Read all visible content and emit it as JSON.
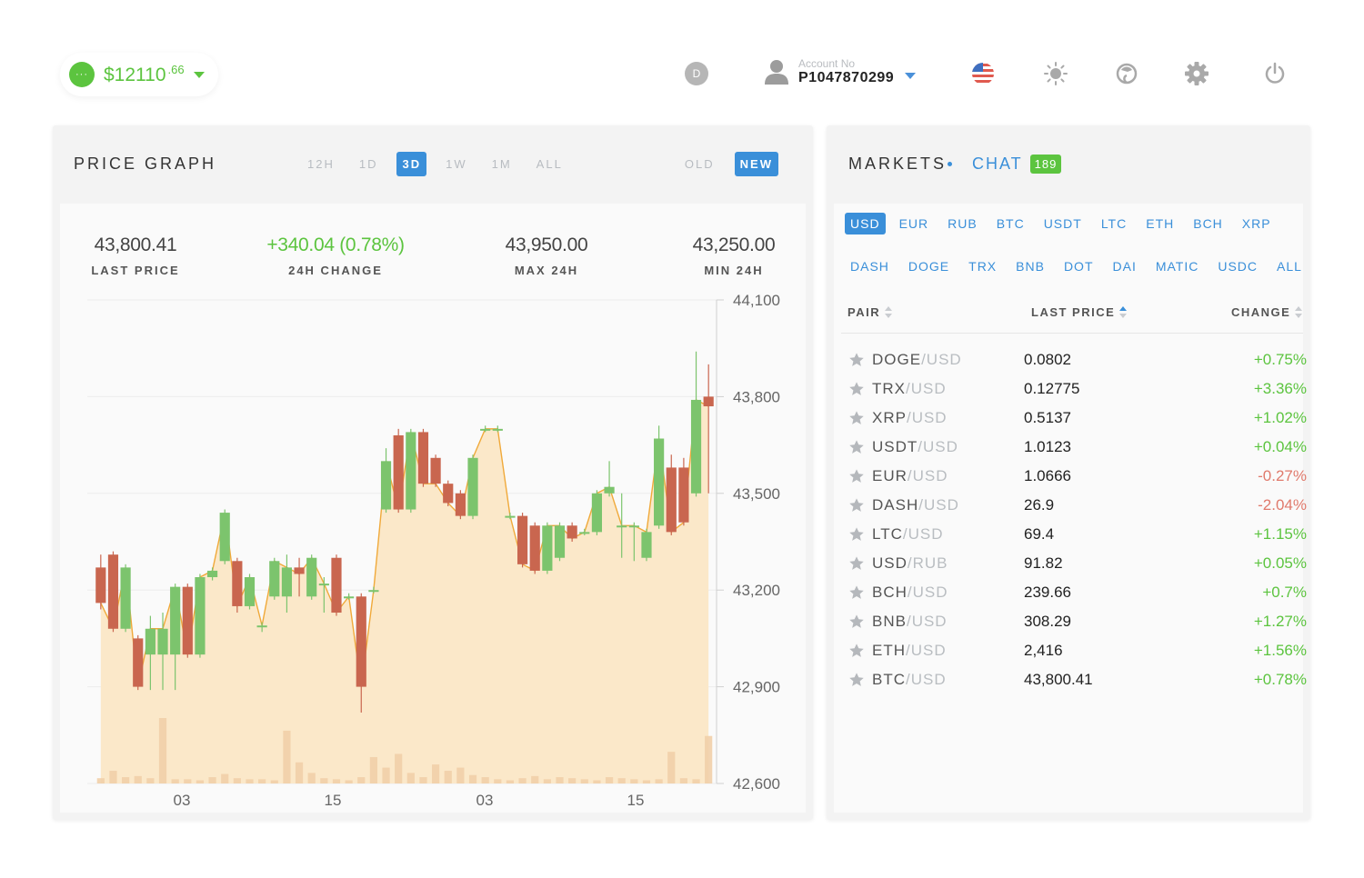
{
  "header": {
    "balance_main": "$12110",
    "balance_cents": ".66",
    "balance_dot": "···",
    "user_initial": "D",
    "account_label": "Account No",
    "account_number": "P1047870299"
  },
  "price_graph": {
    "title": "PRICE GRAPH",
    "range_tabs": [
      "12H",
      "1D",
      "3D",
      "1W",
      "1M",
      "ALL"
    ],
    "active_range": "3D",
    "version_tabs": [
      "OLD",
      "NEW"
    ],
    "active_version": "NEW",
    "stats": {
      "last_price": {
        "value": "43,800.41",
        "label": "LAST PRICE"
      },
      "change_24h": {
        "value": "+340.04 (0.78%)",
        "label": "24H CHANGE"
      },
      "max_24h": {
        "value": "43,950.00",
        "label": "MAX 24H"
      },
      "min_24h": {
        "value": "43,250.00",
        "label": "MIN 24H"
      }
    }
  },
  "colors": {
    "accent": "#3a8fd9",
    "positive": "#5cc43f",
    "negative": "#e07a6c",
    "candle_up": "#7cc46d",
    "candle_down": "#c9664f",
    "area_fill": "#fbe8c9",
    "line": "#f0a93a"
  },
  "chart_data": {
    "type": "candlestick",
    "y_ticks": [
      "44,100",
      "43,800",
      "43,500",
      "43,200",
      "42,900",
      "42,600"
    ],
    "x_ticks": [
      "03",
      "15",
      "03",
      "15"
    ],
    "ylim": [
      42600,
      44100
    ],
    "candles": [
      {
        "o": 43270,
        "c": 43160,
        "h": 43310,
        "l": 43140
      },
      {
        "o": 43310,
        "c": 43080,
        "h": 43320,
        "l": 43070
      },
      {
        "o": 43080,
        "c": 43270,
        "h": 43280,
        "l": 43070
      },
      {
        "o": 43050,
        "c": 42900,
        "h": 43060,
        "l": 42890
      },
      {
        "o": 43000,
        "c": 43080,
        "h": 43120,
        "l": 42890
      },
      {
        "o": 43000,
        "c": 43080,
        "h": 43130,
        "l": 42890
      },
      {
        "o": 43000,
        "c": 43210,
        "h": 43220,
        "l": 42890
      },
      {
        "o": 43210,
        "c": 43000,
        "h": 43220,
        "l": 42990
      },
      {
        "o": 43000,
        "c": 43240,
        "h": 43250,
        "l": 42990
      },
      {
        "o": 43240,
        "c": 43260,
        "h": 43270,
        "l": 43230
      },
      {
        "o": 43290,
        "c": 43440,
        "h": 43450,
        "l": 43280
      },
      {
        "o": 43290,
        "c": 43150,
        "h": 43300,
        "l": 43130
      },
      {
        "o": 43150,
        "c": 43240,
        "h": 43250,
        "l": 43140
      },
      {
        "o": 43090,
        "c": 43090,
        "h": 43100,
        "l": 43070
      },
      {
        "o": 43180,
        "c": 43290,
        "h": 43300,
        "l": 43170
      },
      {
        "o": 43180,
        "c": 43270,
        "h": 43310,
        "l": 43130
      },
      {
        "o": 43270,
        "c": 43250,
        "h": 43300,
        "l": 43180
      },
      {
        "o": 43180,
        "c": 43300,
        "h": 43310,
        "l": 43170
      },
      {
        "o": 43220,
        "c": 43220,
        "h": 43240,
        "l": 43130
      },
      {
        "o": 43300,
        "c": 43130,
        "h": 43310,
        "l": 43120
      },
      {
        "o": 43180,
        "c": 43180,
        "h": 43190,
        "l": 43170
      },
      {
        "o": 43180,
        "c": 42900,
        "h": 43190,
        "l": 42820
      },
      {
        "o": 43200,
        "c": 43200,
        "h": 43210,
        "l": 43190
      },
      {
        "o": 43450,
        "c": 43600,
        "h": 43640,
        "l": 43440
      },
      {
        "o": 43680,
        "c": 43450,
        "h": 43700,
        "l": 43440
      },
      {
        "o": 43450,
        "c": 43690,
        "h": 43700,
        "l": 43440
      },
      {
        "o": 43690,
        "c": 43530,
        "h": 43700,
        "l": 43520
      },
      {
        "o": 43610,
        "c": 43530,
        "h": 43620,
        "l": 43520
      },
      {
        "o": 43530,
        "c": 43470,
        "h": 43540,
        "l": 43460
      },
      {
        "o": 43500,
        "c": 43430,
        "h": 43510,
        "l": 43420
      },
      {
        "o": 43430,
        "c": 43610,
        "h": 43620,
        "l": 43420
      },
      {
        "o": 43700,
        "c": 43700,
        "h": 43710,
        "l": 43690
      },
      {
        "o": 43700,
        "c": 43700,
        "h": 43710,
        "l": 43690
      },
      {
        "o": 43430,
        "c": 43430,
        "h": 43440,
        "l": 43420
      },
      {
        "o": 43430,
        "c": 43280,
        "h": 43440,
        "l": 43270
      },
      {
        "o": 43400,
        "c": 43260,
        "h": 43410,
        "l": 43250
      },
      {
        "o": 43260,
        "c": 43400,
        "h": 43410,
        "l": 43250
      },
      {
        "o": 43300,
        "c": 43400,
        "h": 43410,
        "l": 43290
      },
      {
        "o": 43400,
        "c": 43360,
        "h": 43410,
        "l": 43350
      },
      {
        "o": 43380,
        "c": 43380,
        "h": 43390,
        "l": 43370
      },
      {
        "o": 43380,
        "c": 43500,
        "h": 43510,
        "l": 43370
      },
      {
        "o": 43500,
        "c": 43520,
        "h": 43600,
        "l": 43490
      },
      {
        "o": 43400,
        "c": 43400,
        "h": 43500,
        "l": 43300
      },
      {
        "o": 43400,
        "c": 43400,
        "h": 43410,
        "l": 43290
      },
      {
        "o": 43300,
        "c": 43380,
        "h": 43390,
        "l": 43290
      },
      {
        "o": 43400,
        "c": 43670,
        "h": 43710,
        "l": 43390
      },
      {
        "o": 43580,
        "c": 43380,
        "h": 43620,
        "l": 43370
      },
      {
        "o": 43580,
        "c": 43410,
        "h": 43610,
        "l": 43400
      },
      {
        "o": 43500,
        "c": 43790,
        "h": 43940,
        "l": 43490
      },
      {
        "o": 43800,
        "c": 43770,
        "h": 43900,
        "l": 43500
      }
    ],
    "volumes": [
      5,
      12,
      6,
      7,
      5,
      62,
      4,
      4,
      3,
      6,
      9,
      5,
      4,
      4,
      3,
      50,
      20,
      10,
      5,
      4,
      3,
      6,
      25,
      15,
      28,
      10,
      6,
      18,
      12,
      15,
      8,
      6,
      4,
      3,
      5,
      7,
      4,
      6,
      5,
      4,
      3,
      6,
      5,
      4,
      3,
      4,
      30,
      5,
      4,
      45
    ]
  },
  "markets": {
    "title": "MARKETS",
    "chat_label": "CHAT",
    "chat_count": "189",
    "currency_row1": [
      "USD",
      "EUR",
      "RUB",
      "BTC",
      "USDT",
      "LTC",
      "ETH",
      "BCH",
      "XRP"
    ],
    "currency_row2": [
      "DASH",
      "DOGE",
      "TRX",
      "BNB",
      "DOT",
      "DAI",
      "MATIC",
      "USDC",
      "ALL"
    ],
    "active_currency": "USD",
    "columns": {
      "pair": "PAIR",
      "last_price": "LAST PRICE",
      "change": "CHANGE"
    },
    "rows": [
      {
        "base": "DOGE",
        "quote": "/USD",
        "price": "0.0802",
        "change": "+0.75%",
        "positive": true
      },
      {
        "base": "TRX",
        "quote": "/USD",
        "price": "0.12775",
        "change": "+3.36%",
        "positive": true
      },
      {
        "base": "XRP",
        "quote": "/USD",
        "price": "0.5137",
        "change": "+1.02%",
        "positive": true
      },
      {
        "base": "USDT",
        "quote": "/USD",
        "price": "1.0123",
        "change": "+0.04%",
        "positive": true
      },
      {
        "base": "EUR",
        "quote": "/USD",
        "price": "1.0666",
        "change": "-0.27%",
        "positive": false
      },
      {
        "base": "DASH",
        "quote": "/USD",
        "price": "26.9",
        "change": "-2.04%",
        "positive": false
      },
      {
        "base": "LTC",
        "quote": "/USD",
        "price": "69.4",
        "change": "+1.15%",
        "positive": true
      },
      {
        "base": "USD",
        "quote": "/RUB",
        "price": "91.82",
        "change": "+0.05%",
        "positive": true
      },
      {
        "base": "BCH",
        "quote": "/USD",
        "price": "239.66",
        "change": "+0.7%",
        "positive": true
      },
      {
        "base": "BNB",
        "quote": "/USD",
        "price": "308.29",
        "change": "+1.27%",
        "positive": true
      },
      {
        "base": "ETH",
        "quote": "/USD",
        "price": "2,416",
        "change": "+1.56%",
        "positive": true
      },
      {
        "base": "BTC",
        "quote": "/USD",
        "price": "43,800.41",
        "change": "+0.78%",
        "positive": true
      }
    ]
  }
}
